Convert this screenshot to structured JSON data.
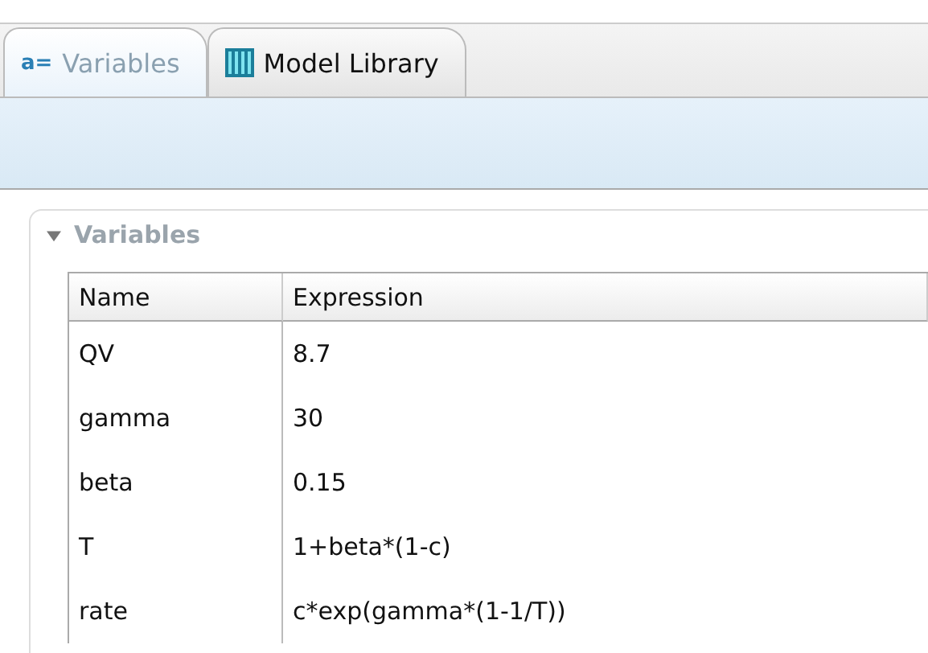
{
  "tabs": [
    {
      "kind": "text-icon",
      "icon_text": "a=",
      "label": "Variables",
      "selected": true
    },
    {
      "kind": "library",
      "label": "Model Library",
      "selected": false
    }
  ],
  "section": {
    "title": "Variables",
    "expanded": true
  },
  "table": {
    "columns": [
      "Name",
      "Expression"
    ],
    "rows": [
      [
        "QV",
        "8.7"
      ],
      [
        "gamma",
        "30"
      ],
      [
        "beta",
        "0.15"
      ],
      [
        "T",
        "1+beta*(1-c)"
      ],
      [
        "rate",
        "c*exp(gamma*(1-1/T))"
      ]
    ]
  }
}
